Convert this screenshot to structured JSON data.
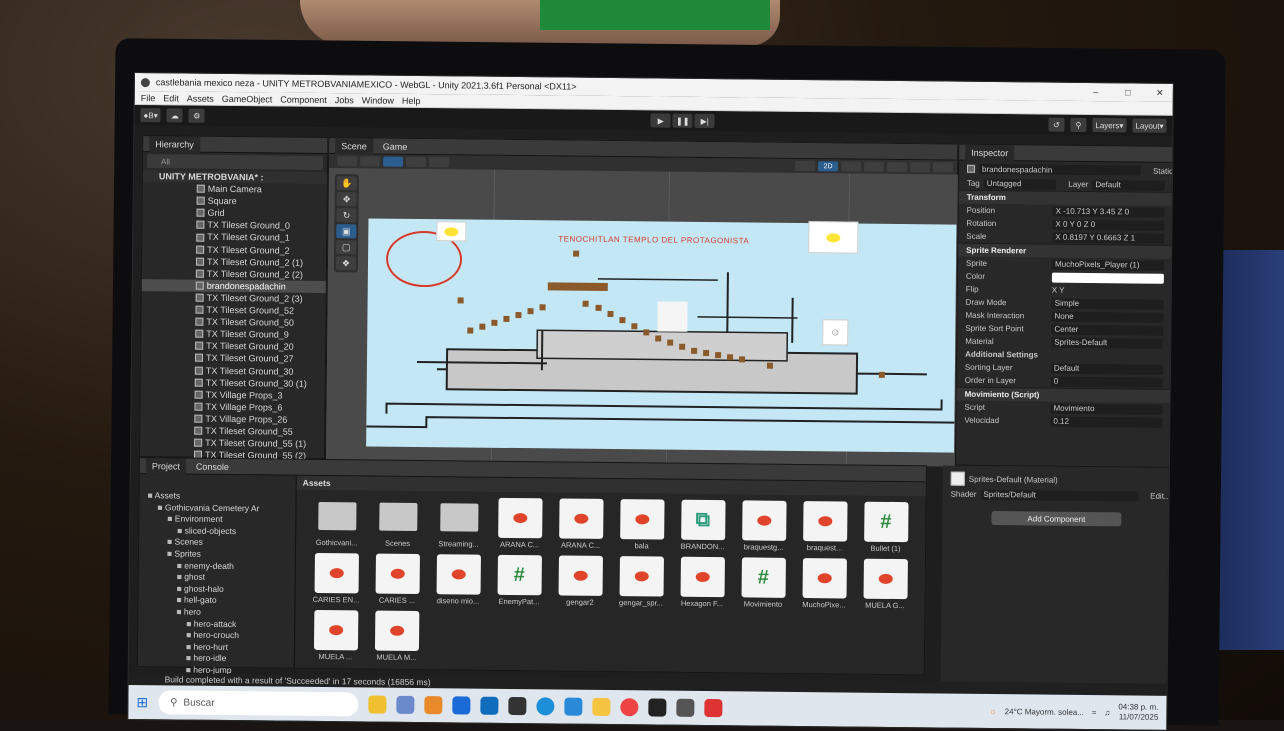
{
  "window": {
    "title": "castlebania mexico neza - UNITY METROBVANIAMEXICO - WebGL - Unity 2021.3.6f1 Personal <DX11>"
  },
  "menu": [
    "File",
    "Edit",
    "Assets",
    "GameObject",
    "Component",
    "Jobs",
    "Window",
    "Help"
  ],
  "toolbar": {
    "account": "B",
    "layers": "Layers",
    "layout": "Layout",
    "view_2d": "2D"
  },
  "tabs": {
    "hierarchy": "Hierarchy",
    "scene": "Scene",
    "game": "Game",
    "inspector": "Inspector",
    "project": "Project",
    "console": "Console"
  },
  "hierarchy": {
    "search_placeholder": "All",
    "root": "UNITY METROBVANIA* :",
    "items": [
      "Main Camera",
      "Square",
      "Grid",
      "TX Tileset Ground_0",
      "TX Tileset Ground_1",
      "TX Tileset Ground_2",
      "TX Tileset Ground_2 (1)",
      "TX Tileset Ground_2 (2)",
      "brandonespadachin",
      "TX Tileset Ground_2 (3)",
      "TX Tileset Ground_52",
      "TX Tileset Ground_50",
      "TX Tileset Ground_9",
      "TX Tileset Ground_20",
      "TX Tileset Ground_27",
      "TX Tileset Ground_30",
      "TX Tileset Ground_30 (1)",
      "TX Village Props_3",
      "TX Village Props_6",
      "TX Village Props_26",
      "TX Tileset Ground_55",
      "TX Tileset Ground_55 (1)",
      "TX Tileset Ground_55 (2)"
    ],
    "selected_index": 8
  },
  "scene": {
    "overlay_text": "TENOCHITLAN TEMPLO DEL PROTAGONISTA"
  },
  "inspector": {
    "object_name": "brandonespadachin",
    "static": "Static",
    "tag_label": "Tag",
    "tag": "Untagged",
    "layer_label": "Layer",
    "layer": "Default",
    "transform": {
      "title": "Transform",
      "position_label": "Position",
      "position": "X -10.713  Y 3.45  Z 0",
      "rotation_label": "Rotation",
      "rotation": "X 0  Y 0  Z 0",
      "scale_label": "Scale",
      "scale": "X 0.8197  Y 0.6663  Z 1"
    },
    "sprite_renderer": {
      "title": "Sprite Renderer",
      "sprite_label": "Sprite",
      "sprite": "MuchoPixels_Player (1)",
      "color_label": "Color",
      "flip_label": "Flip",
      "flip": "X  Y",
      "draw_mode_label": "Draw Mode",
      "draw_mode": "Simple",
      "mask_label": "Mask Interaction",
      "mask": "None",
      "pivot_label": "Sprite Sort Point",
      "pivot": "Center",
      "material_label": "Material",
      "material": "Sprites-Default",
      "additional": "Additional Settings",
      "sorting_label": "Sorting Layer",
      "sorting": "Default",
      "order_label": "Order in Layer",
      "order": "0"
    },
    "movimiento": {
      "title": "Movimiento (Script)",
      "script_label": "Script",
      "script": "Movimiento",
      "velocidad_label": "Velocidad",
      "velocidad": "0.12"
    },
    "material_footer": "Sprites-Default (Material)",
    "shader_label": "Shader",
    "shader": "Sprites/Default",
    "edit": "Edit...",
    "add_component": "Add Component"
  },
  "project": {
    "assets_header": "Assets",
    "tree": [
      {
        "label": "Assets",
        "depth": 0
      },
      {
        "label": "Gothicvania Cemetery Ar",
        "depth": 1
      },
      {
        "label": "Environment",
        "depth": 2
      },
      {
        "label": "sliced-objects",
        "depth": 3
      },
      {
        "label": "Scenes",
        "depth": 2
      },
      {
        "label": "Sprites",
        "depth": 2
      },
      {
        "label": "enemy-death",
        "depth": 3
      },
      {
        "label": "ghost",
        "depth": 3
      },
      {
        "label": "ghost-halo",
        "depth": 3
      },
      {
        "label": "hell-gato",
        "depth": 3
      },
      {
        "label": "hero",
        "depth": 3
      },
      {
        "label": "hero-attack",
        "depth": 4
      },
      {
        "label": "hero-crouch",
        "depth": 4
      },
      {
        "label": "hero-hurt",
        "depth": 4
      },
      {
        "label": "hero-idle",
        "depth": 4
      },
      {
        "label": "hero-jump",
        "depth": 4
      }
    ],
    "assets": [
      {
        "name": "Gothicvani...",
        "kind": "folder"
      },
      {
        "name": "Scenes",
        "kind": "folder"
      },
      {
        "name": "Streaming...",
        "kind": "folder"
      },
      {
        "name": "ARANA C...",
        "kind": "sprite"
      },
      {
        "name": "ARANA C...",
        "kind": "sprite"
      },
      {
        "name": "bala",
        "kind": "sprite"
      },
      {
        "name": "BRANDON...",
        "kind": "anim"
      },
      {
        "name": "braquestg...",
        "kind": "sprite"
      },
      {
        "name": "braquest...",
        "kind": "sprite"
      },
      {
        "name": "Bullet (1)",
        "kind": "script"
      },
      {
        "name": "CARIES EN...",
        "kind": "sprite"
      },
      {
        "name": "CARIES ...",
        "kind": "sprite"
      },
      {
        "name": "diseno mio...",
        "kind": "sprite"
      },
      {
        "name": "EnemyPat...",
        "kind": "script"
      },
      {
        "name": "gengar2",
        "kind": "sprite"
      },
      {
        "name": "gengar_spr...",
        "kind": "sprite"
      },
      {
        "name": "Hexagon F...",
        "kind": "sprite"
      },
      {
        "name": "Movimiento",
        "kind": "script"
      },
      {
        "name": "MuchoPixe...",
        "kind": "sprite"
      },
      {
        "name": "MUELA G...",
        "kind": "sprite"
      },
      {
        "name": "MUELA ...",
        "kind": "sprite"
      },
      {
        "name": "MUELA M...",
        "kind": "sprite"
      }
    ]
  },
  "status": {
    "message": "Build completed with a result of 'Succeeded' in 17 seconds (16856 ms)"
  },
  "taskbar": {
    "search": "Buscar",
    "weather": "24°C  Mayorm. solea...",
    "time": "04:38 p. m.",
    "date": "11/07/2025"
  },
  "colors": {
    "unity_dark": "#282828",
    "game_bg": "#c3e7f5",
    "accent": "#2c5d8f",
    "circle": "#d83a2a"
  }
}
